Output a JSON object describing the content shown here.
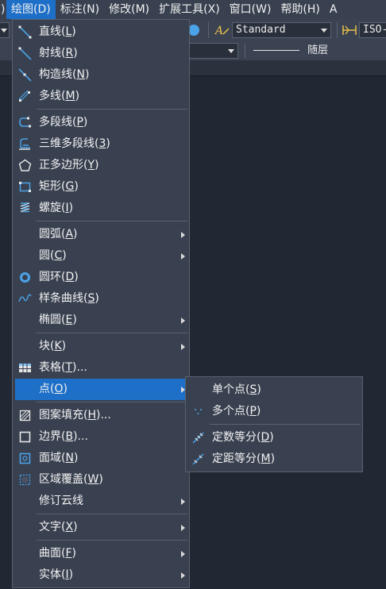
{
  "menubar": {
    "lead": ")",
    "items": [
      {
        "label": "绘图(D)",
        "active": true
      },
      {
        "label": "标注(N)"
      },
      {
        "label": "修改(M)"
      },
      {
        "label": "扩展工具(X)"
      },
      {
        "label": "窗口(W)"
      },
      {
        "label": "帮助(H)"
      },
      {
        "label": "A"
      }
    ]
  },
  "toolbar": {
    "text_style": "Standard",
    "dim_style": "ISO-",
    "linetype": "随层"
  },
  "draw_menu": {
    "groups": [
      [
        {
          "text": "直线",
          "key": "L",
          "icon": "line-icon"
        },
        {
          "text": "射线",
          "key": "R",
          "icon": "ray-icon"
        },
        {
          "text": "构造线",
          "key": "N",
          "icon": "construction-line-icon"
        },
        {
          "text": "多线",
          "key": "M",
          "icon": "multiline-icon"
        }
      ],
      [
        {
          "text": "多段线",
          "key": "P",
          "icon": "polyline-icon"
        },
        {
          "text": "三维多段线",
          "key": "3",
          "icon": "3d-polyline-icon"
        },
        {
          "text": "正多边形",
          "key": "Y",
          "icon": "polygon-icon"
        },
        {
          "text": "矩形",
          "key": "G",
          "icon": "rectangle-icon"
        },
        {
          "text": "螺旋",
          "key": "I",
          "icon": "helix-icon"
        }
      ],
      [
        {
          "text": "圆弧",
          "key": "A",
          "submenu": true
        },
        {
          "text": "圆",
          "key": "C",
          "submenu": true
        },
        {
          "text": "圆环",
          "key": "D",
          "icon": "donut-icon"
        },
        {
          "text": "样条曲线",
          "key": "S",
          "icon": "spline-icon"
        },
        {
          "text": "椭圆",
          "key": "E",
          "submenu": true
        }
      ],
      [
        {
          "text": "块",
          "key": "K",
          "submenu": true
        },
        {
          "text": "表格",
          "key": "T",
          "suffix": "...",
          "icon": "table-icon"
        },
        {
          "text": "点",
          "key": "O",
          "submenu": true,
          "highlighted": true
        }
      ],
      [
        {
          "text": "图案填充",
          "key": "H",
          "suffix": "...",
          "icon": "hatch-icon"
        },
        {
          "text": "边界",
          "key": "B",
          "suffix": "...",
          "icon": "boundary-icon"
        },
        {
          "text": "面域",
          "key": "N",
          "icon": "region-icon"
        },
        {
          "text": "区域覆盖",
          "key": "W",
          "icon": "wipeout-icon"
        },
        {
          "text": "修订云线",
          "key": "",
          "submenu": true
        }
      ],
      [
        {
          "text": "文字",
          "key": "X",
          "submenu": true
        }
      ],
      [
        {
          "text": "曲面",
          "key": "F",
          "submenu": true
        },
        {
          "text": "实体",
          "key": "I",
          "submenu": true
        }
      ]
    ]
  },
  "point_submenu": {
    "groups": [
      [
        {
          "text": "单个点",
          "key": "S",
          "icon": ""
        },
        {
          "text": "多个点",
          "key": "P",
          "icon": "multiple-points-icon"
        }
      ],
      [
        {
          "text": "定数等分",
          "key": "D",
          "icon": "divide-icon"
        },
        {
          "text": "定距等分",
          "key": "M",
          "icon": "measure-icon"
        }
      ]
    ]
  },
  "colors": {
    "menu_bg": "#394150",
    "highlight": "#1e6fc8",
    "icon_blue": "#4aa3e8",
    "background": "#212733"
  }
}
